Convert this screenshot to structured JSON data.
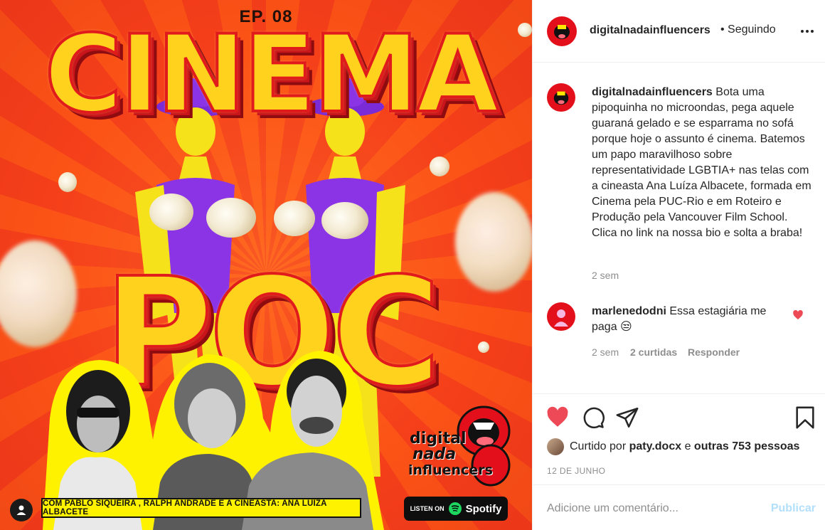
{
  "poster": {
    "episode": "EP. 08",
    "title_top": "CINEMA",
    "title_bottom": "POC",
    "credits": "COM PABLO SIQUEIRA , RALPH ANDRADE E  A CINEASTA: ANA LUÍZA ALBACETE",
    "spotify_prefix": "LISTEN ON",
    "spotify_label": "Spotify",
    "brand_line1": "digital",
    "brand_line2": "nada",
    "brand_line3": "influencers"
  },
  "header": {
    "username": "digitalnadainfluencers",
    "follow_state": "• Seguindo",
    "more_icon": "more-horizontal-icon"
  },
  "caption": {
    "username": "digitalnadainfluencers",
    "text": "Bota uma pipoquinha no microondas, pega aquele guaraná gelado e se esparrama no sofá porque hoje o assunto é cinema. Batemos um papo maravilhoso sobre representatividade LGBTIA+ nas telas com a cineasta Ana Luíza Albacete, formada em Cinema pela PUC-Rio e em Roteiro e Produção pela Vancouver Film School. Clica no link na nossa bio e solta a braba!",
    "time": "2 sem"
  },
  "comments": [
    {
      "username": "marlenedodni",
      "text": "Essa estagiária me paga 😒",
      "time": "2 sem",
      "likes": "2 curtidas",
      "reply": "Responder"
    }
  ],
  "actions": {
    "like_icon": "heart-filled-icon",
    "comment_icon": "comment-icon",
    "share_icon": "send-icon",
    "save_icon": "bookmark-icon",
    "liked_prefix": "Curtido por",
    "liked_by": "paty.docx",
    "liked_conj": "e",
    "liked_others": "outras 753 pessoas",
    "date": "12 DE JUNHO"
  },
  "composer": {
    "placeholder": "Adicione um comentário...",
    "publish": "Publicar"
  },
  "colors": {
    "like_red": "#ed4956",
    "poster_orange": "#ff5a17",
    "publish_disabled": "#b2dffc"
  }
}
